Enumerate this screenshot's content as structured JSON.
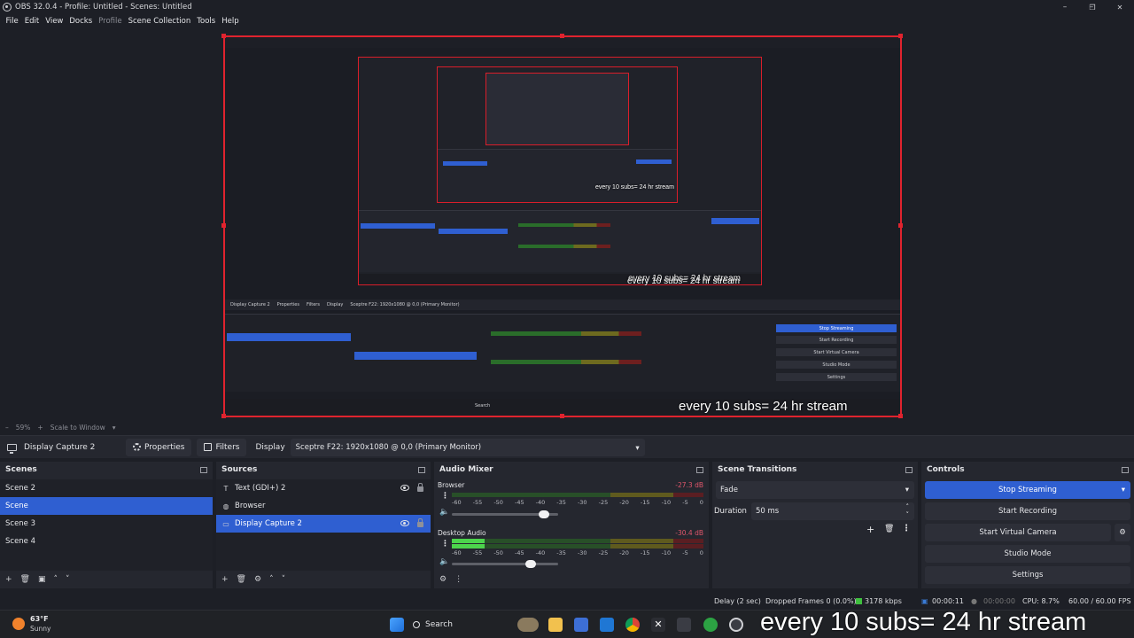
{
  "window": {
    "title": "OBS 32.0.4 - Profile: Untitled - Scenes: Untitled",
    "minimize": "–",
    "restore": "❐",
    "close": "✕"
  },
  "menu": {
    "file": "File",
    "edit": "Edit",
    "view": "View",
    "docks": "Docks",
    "profile": "Profile",
    "scene_collection": "Scene Collection",
    "tools": "Tools",
    "help": "Help"
  },
  "preview": {
    "overlay_main": "every 10 subs= 24 hr stream",
    "overlay_nested_1": "every 10 subs= 24 hr stream",
    "overlay_nested_2": "every 10 subs= 24 hr stream",
    "overlay_nested_3": "every 10 subs= 24 hr stream",
    "nested_context_source": "Display Capture 2",
    "nested_properties": "Properties",
    "nested_filters": "Filters",
    "nested_display": "Display",
    "nested_display_value": "Sceptre F22: 1920x1080 @ 0,0 (Primary Monitor)",
    "nested_stop_streaming": "Stop Streaming",
    "nested_start_recording": "Start Recording",
    "nested_start_virtual": "Start Virtual Camera",
    "nested_studio_mode": "Studio Mode",
    "nested_settings": "Settings",
    "nested_search": "Search"
  },
  "zoom": {
    "level": "59%",
    "scale_mode": "Scale to Window"
  },
  "context_bar": {
    "source_name": "Display Capture 2",
    "properties_label": "Properties",
    "filters_label": "Filters",
    "display_label": "Display",
    "display_value": "Sceptre F22: 1920x1080 @ 0,0 (Primary Monitor)"
  },
  "scenes": {
    "title": "Scenes",
    "items": [
      "Scene 2",
      "Scene",
      "Scene 3",
      "Scene 4"
    ],
    "selected_index": 1
  },
  "sources": {
    "title": "Sources",
    "items": [
      {
        "name": "Text (GDI+) 2",
        "icon": "text-icon"
      },
      {
        "name": "Browser",
        "icon": "globe-icon"
      },
      {
        "name": "Display Capture 2",
        "icon": "monitor-icon"
      }
    ],
    "selected_index": 2
  },
  "audio_mixer": {
    "title": "Audio Mixer",
    "channels": [
      {
        "name": "Browser",
        "db": "-27.3 dB",
        "level": 0.0,
        "volume": 0.82
      },
      {
        "name": "Desktop Audio",
        "db": "-30.4 dB",
        "level": 0.13,
        "volume": 0.69
      }
    ],
    "ticks": [
      "-60",
      "-55",
      "-50",
      "-45",
      "-40",
      "-35",
      "-30",
      "-25",
      "-20",
      "-15",
      "-10",
      "-5",
      "0"
    ]
  },
  "transitions": {
    "title": "Scene Transitions",
    "type": "Fade",
    "duration_label": "Duration",
    "duration_value": "50 ms"
  },
  "controls": {
    "title": "Controls",
    "stop_streaming": "Stop Streaming",
    "start_recording": "Start Recording",
    "start_virtual_camera": "Start Virtual Camera",
    "studio_mode": "Studio Mode",
    "settings": "Settings"
  },
  "status": {
    "delay": "Delay (2 sec)",
    "dropped": "Dropped Frames 0 (0.0%)",
    "bitrate": "3178 kbps",
    "stream_time": "00:00:11",
    "record_time": "00:00:00",
    "cpu": "CPU: 8.7%",
    "fps": "60.00 / 60.00 FPS"
  },
  "taskbar": {
    "weather_temp": "63°F",
    "weather_desc": "Sunny",
    "search_label": "Search",
    "overlay": "every 10 subs= 24 hr stream"
  },
  "colors": {
    "accent": "#2f5fd1",
    "selection_border": "#e0232e",
    "meter_green": "#4cd44c"
  }
}
